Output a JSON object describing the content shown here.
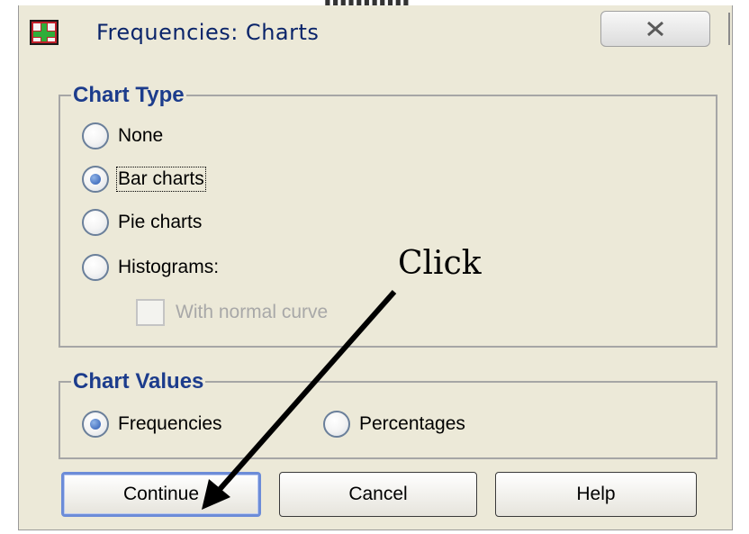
{
  "window": {
    "title": "Frequencies: Charts"
  },
  "icons": {
    "app": "spss-chart-icon",
    "close": "close-icon"
  },
  "chart_type": {
    "legend": "Chart Type",
    "options": [
      {
        "label": "None",
        "mnemonic": "o",
        "selected": false
      },
      {
        "label": "Bar charts",
        "mnemonic": "B",
        "selected": true
      },
      {
        "label": "Pie charts",
        "mnemonic": "P",
        "selected": false
      },
      {
        "label": "Histograms:",
        "mnemonic": "H",
        "selected": false
      }
    ],
    "normal_curve": {
      "label": "With normal curve",
      "mnemonic": "W",
      "checked": false,
      "enabled": false
    }
  },
  "chart_values": {
    "legend": "Chart Values",
    "options": [
      {
        "label": "Frequencies",
        "mnemonic": "F",
        "selected": true
      },
      {
        "label": "Percentages",
        "mnemonic": "c",
        "selected": false
      }
    ]
  },
  "buttons": {
    "continue": "Continue",
    "cancel": "Cancel",
    "help": "Help"
  },
  "annotation": {
    "text": "Click"
  },
  "colors": {
    "dialog_bg": "#ece9d8",
    "legend_text": "#1c3c8c",
    "title_text": "#0a246a",
    "default_button_border": "#6c8cd8",
    "radio_dot": "#2a58b0"
  }
}
